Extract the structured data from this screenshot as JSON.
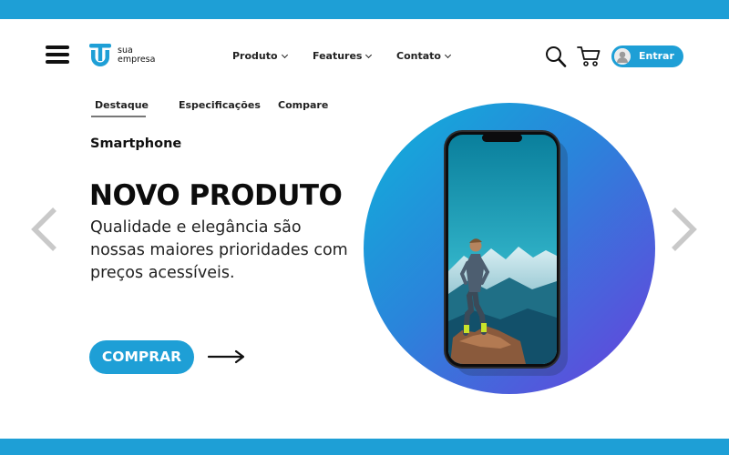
{
  "brand": {
    "line1": "sua",
    "line2": "empresa",
    "primary_color": "#1e9fd6",
    "gradient_start": "#16a7d7",
    "gradient_end": "#6a3fdc"
  },
  "nav": {
    "items": [
      {
        "label": "Produto",
        "icon": "chevron-down-icon"
      },
      {
        "label": "Features",
        "icon": "chevron-down-icon"
      },
      {
        "label": "Contato",
        "icon": "chevron-down-icon"
      }
    ]
  },
  "header": {
    "menu_icon": "hamburger-menu-icon",
    "search_icon": "search-icon",
    "cart_icon": "cart-icon",
    "login_label": "Entrar",
    "login_icon": "user-avatar-icon"
  },
  "tabs": [
    {
      "label": "Destaque",
      "active": true
    },
    {
      "label": "Especificações",
      "active": false
    },
    {
      "label": "Compare",
      "active": false
    }
  ],
  "hero": {
    "eyebrow": "Smartphone",
    "headline": "NOVO PRODUTO",
    "description": "Qualidade e elegância são nossas maiores prioridades com preços acessíveis.",
    "cta_label": "COMPRAR",
    "cta_arrow_icon": "arrow-right-icon",
    "prev_icon": "chevron-left-icon",
    "next_icon": "chevron-right-icon",
    "image": "smartphone-mountain-hiker"
  }
}
